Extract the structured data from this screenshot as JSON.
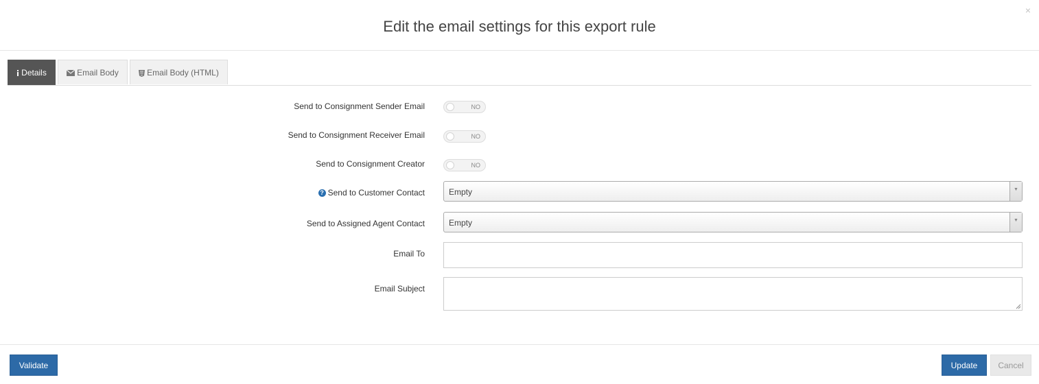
{
  "modal": {
    "title": "Edit the email settings for this export rule",
    "close": "×"
  },
  "tabs": [
    {
      "label": "Details",
      "icon": "info-icon",
      "active": true
    },
    {
      "label": "Email Body",
      "icon": "envelope-icon",
      "active": false
    },
    {
      "label": "Email Body (HTML)",
      "icon": "html5-icon",
      "active": false
    }
  ],
  "form": {
    "sender_email": {
      "label": "Send to Consignment Sender Email",
      "value": "NO"
    },
    "receiver_email": {
      "label": "Send to Consignment Receiver Email",
      "value": "NO"
    },
    "creator": {
      "label": "Send to Consignment Creator",
      "value": "NO"
    },
    "customer_contact": {
      "label": "Send to Customer Contact",
      "value": "Empty"
    },
    "agent_contact": {
      "label": "Send to Assigned Agent Contact",
      "value": "Empty"
    },
    "email_to": {
      "label": "Email To",
      "value": ""
    },
    "email_subject": {
      "label": "Email Subject",
      "value": ""
    }
  },
  "footer": {
    "validate": "Validate",
    "update": "Update",
    "cancel": "Cancel"
  },
  "colors": {
    "primary": "#2d6aa7",
    "active_tab": "#555555"
  }
}
